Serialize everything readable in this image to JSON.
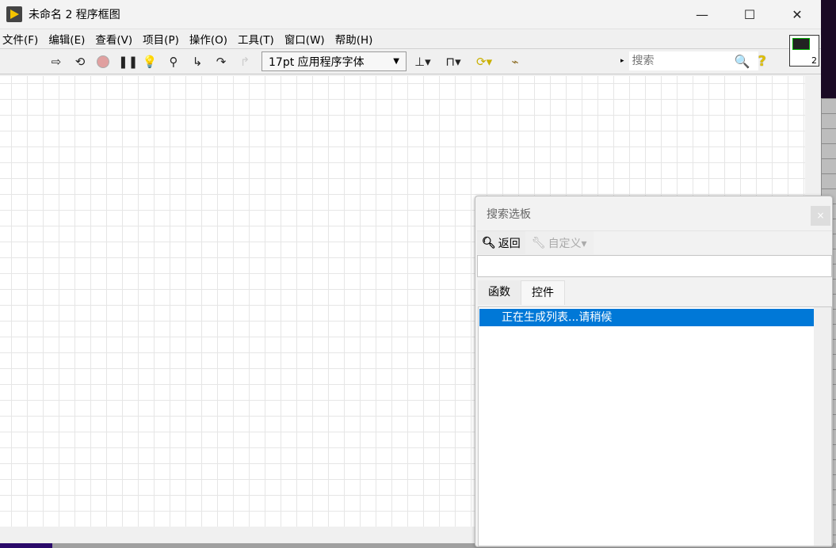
{
  "window": {
    "title": "未命名 2 程序框图",
    "minimize": "—",
    "maximize": "☐",
    "close": "✕"
  },
  "menu": [
    "文件(F)",
    "编辑(E)",
    "查看(V)",
    "项目(P)",
    "操作(O)",
    "工具(T)",
    "窗口(W)",
    "帮助(H)"
  ],
  "toolbar": {
    "font_selector": "17pt 应用程序字体",
    "search_placeholder": "搜索",
    "help": "?"
  },
  "vi_icon": {
    "number": "2"
  },
  "palette": {
    "title": "搜索选板",
    "close": "×",
    "back": "返回",
    "customize": "自定义▾",
    "search_value": "",
    "tabs": [
      "函数",
      "控件"
    ],
    "active_tab": "控件",
    "items": [
      "正在生成列表...请稍候"
    ]
  },
  "colors": {
    "selection": "#0078d7"
  }
}
